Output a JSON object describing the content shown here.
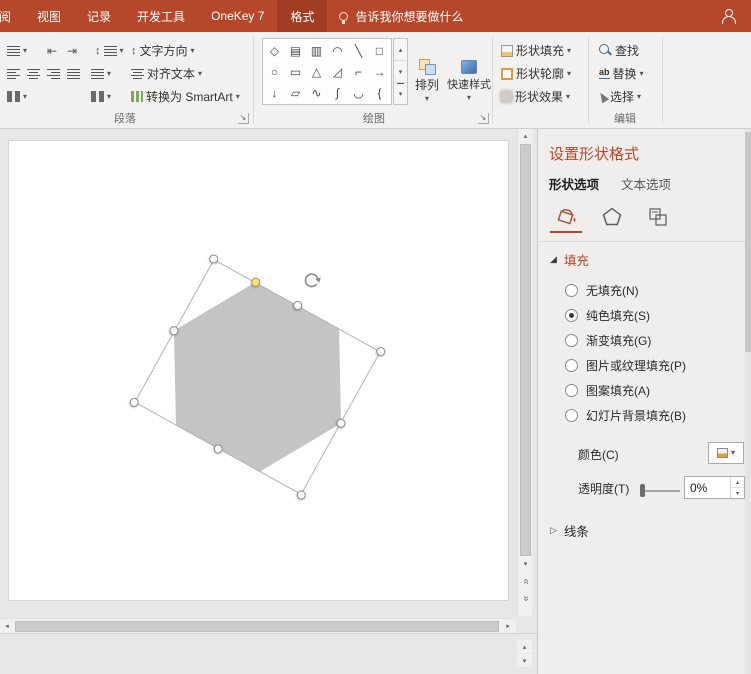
{
  "colors": {
    "accent": "#B7472A",
    "shape_fill": "#C4C4C4"
  },
  "glyphs": {
    "dd": "▾",
    "up": "▴",
    "down": "▾",
    "left": "◂",
    "right": "▸",
    "chev": "«",
    "launcher": "↘",
    "indent_left": "⇤",
    "indent_right": "⇥",
    "line_spacing": "↕",
    "tri_expanded": "◢",
    "tri_collapsed": "▷"
  },
  "titlebar": {
    "tabs": [
      {
        "label": "审阅",
        "active": false
      },
      {
        "label": "视图",
        "active": false
      },
      {
        "label": "记录",
        "active": false
      },
      {
        "label": "开发工具",
        "active": false
      },
      {
        "label": "OneKey 7",
        "active": false
      },
      {
        "label": "格式",
        "active": true
      }
    ],
    "tellme": "告诉我你想要做什么"
  },
  "ribbon": {
    "paragraph": {
      "label": "段落",
      "text_direction": "文字方向",
      "align_text": "对齐文本",
      "convert_smartart": "转换为 SmartArt"
    },
    "drawing": {
      "label": "绘图",
      "shapes": [
        "◇",
        "▤",
        "▥",
        "◠",
        "╲",
        "□",
        "○",
        "▭",
        "△",
        "◿",
        "⌐",
        "→",
        "↓",
        "▱",
        "∿",
        "∫",
        "◡",
        "{"
      ],
      "arrange": "排列",
      "quick_styles": "快速样式"
    },
    "shape_styles": {
      "fill": "形状填充",
      "outline": "形状轮廓",
      "effects": "形状效果"
    },
    "editing": {
      "label": "编辑",
      "find": "查找",
      "replace": "替换",
      "select": "选择",
      "replace_icon": "ab"
    }
  },
  "panel": {
    "title": "设置形状格式",
    "tabs": [
      {
        "label": "形状选项",
        "active": true
      },
      {
        "label": "文本选项",
        "active": false
      }
    ],
    "fill": {
      "header": "填充",
      "expanded": true,
      "options": [
        {
          "label": "无填充(N)",
          "selected": false
        },
        {
          "label": "纯色填充(S)",
          "selected": true
        },
        {
          "label": "渐变填充(G)",
          "selected": false
        },
        {
          "label": "图片或纹理填充(P)",
          "selected": false
        },
        {
          "label": "图案填充(A)",
          "selected": false
        },
        {
          "label": "幻灯片背景填充(B)",
          "selected": false
        }
      ],
      "color_label": "颜色(C)",
      "transparency_label": "透明度(T)",
      "transparency_value": "0%"
    },
    "line": {
      "header": "线条",
      "expanded": false
    }
  }
}
